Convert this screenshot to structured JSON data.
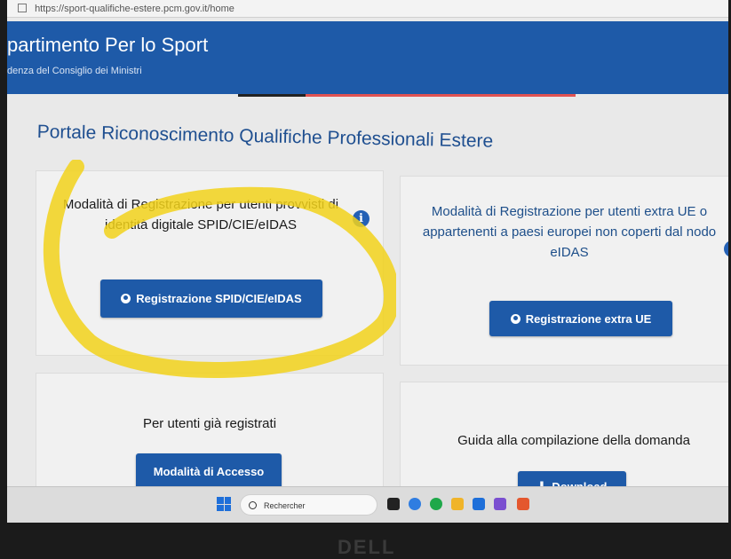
{
  "browser": {
    "url": "https://sport-qualifiche-estere.pcm.gov.it/home"
  },
  "header": {
    "title": "partimento Per lo Sport",
    "subtitle": "denza del Consiglio dei Ministri"
  },
  "portal_title": "Portale Riconoscimento Qualifiche Professionali Estere",
  "cards": {
    "spid": {
      "text": "Modalità di Registrazione per utenti provvisti di identità digitale SPID/CIE/eIDAS",
      "button": "Registrazione SPID/CIE/eIDAS"
    },
    "extra": {
      "text": "Modalità di Registrazione per utenti extra UE o appartenenti a paesi europei non coperti dal nodo eIDAS",
      "button": "Registrazione extra UE"
    },
    "logged": {
      "text": "Per utenti già registrati",
      "button": "Modalità di Accesso"
    },
    "guide": {
      "text": "Guida alla compilazione della domanda",
      "button": "Download"
    }
  },
  "taskbar": {
    "search_placeholder": "Rechercher"
  },
  "bezel": {
    "brand": "DELL"
  },
  "colors": {
    "primary": "#1e5aa8",
    "highlight": "#f2d21b"
  }
}
